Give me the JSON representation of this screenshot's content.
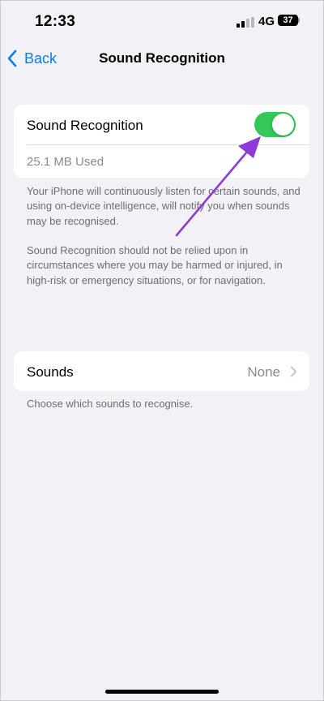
{
  "status_bar": {
    "time": "12:33",
    "network": "4G",
    "battery": "37"
  },
  "nav": {
    "back_label": "Back",
    "title": "Sound Recognition"
  },
  "recognition": {
    "label": "Sound Recognition",
    "toggle_on": true,
    "storage_used": "25.1 MB Used",
    "footnote_1": "Your iPhone will continuously listen for certain sounds, and using on-device intelligence, will notify you when sounds may be recognised.",
    "footnote_2": "Sound Recognition should not be relied upon in circumstances where you may be harmed or injured, in high-risk or emergency situations, or for navigation."
  },
  "sounds": {
    "label": "Sounds",
    "value": "None",
    "footnote": "Choose which sounds to recognise."
  },
  "colors": {
    "accent": "#0a7aff",
    "toggle_on": "#34c759",
    "annotation_arrow": "#8d3ad6",
    "background": "#f2f1f6"
  },
  "icons": {
    "back": "chevron-left-icon",
    "row": "chevron-right-icon",
    "annotation": "arrow-icon"
  }
}
